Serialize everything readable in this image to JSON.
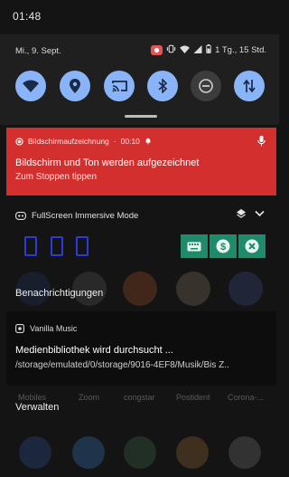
{
  "status_bar": {
    "time": "01:48"
  },
  "quick_settings": {
    "date": "Mi., 9. Sept.",
    "battery_text": "1 Tg., 15 Std.",
    "tiles": [
      {
        "icon": "wifi-icon",
        "active": true
      },
      {
        "icon": "location-icon",
        "active": true
      },
      {
        "icon": "cast-icon",
        "active": true
      },
      {
        "icon": "bluetooth-icon",
        "active": true
      },
      {
        "icon": "do-not-disturb-icon",
        "active": false
      },
      {
        "icon": "data-transfer-icon",
        "active": true
      }
    ]
  },
  "recording_notification": {
    "app": "Bildschirmaufzeichnung",
    "time": "00:10",
    "title": "Bildschirm und Ton werden aufgezeichnet",
    "subtitle": "Zum Stoppen tippen",
    "color": "#d32f2f"
  },
  "fullscreen_notification": {
    "app": "FullScreen Immersive Mode",
    "action_color": "#1f8b6a"
  },
  "section_notifications": "Benachrichtigungen",
  "vanilla_notification": {
    "app": "Vanilla Music",
    "title": "Medienbibliothek wird durchsucht ...",
    "path": "/storage/emulated/0/storage/9016-4EF8/Musik/Bis Z.."
  },
  "bg_labels": [
    "Mobiles",
    "Zoom",
    "congstar",
    "Postident",
    "Corona-..."
  ],
  "section_manage": "Verwalten"
}
